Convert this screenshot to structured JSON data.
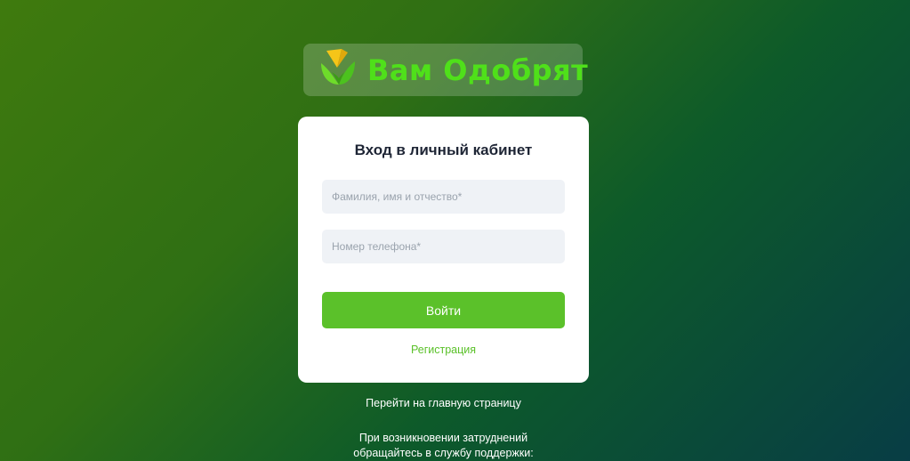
{
  "logo": {
    "text": "Вам Одобрят",
    "icon": "leaf-sun-logo-icon"
  },
  "login_form": {
    "title": "Вход в личный кабинет",
    "name_placeholder": "Фамилия, имя и отчество*",
    "phone_placeholder": "Номер телефона*",
    "name_value": "",
    "phone_value": "",
    "submit_label": "Войти",
    "register_label": "Регистрация"
  },
  "footer": {
    "home_link": "Перейти на главную страницу",
    "support_line_1": "При возникновении затруднений",
    "support_line_2": "обращайтесь в службу поддержки:"
  },
  "colors": {
    "accent": "#5bc12a",
    "logo_text": "#4fe01a",
    "input_bg": "#eff2f6",
    "background_start": "#3f7a0e",
    "background_end": "#083d45"
  }
}
